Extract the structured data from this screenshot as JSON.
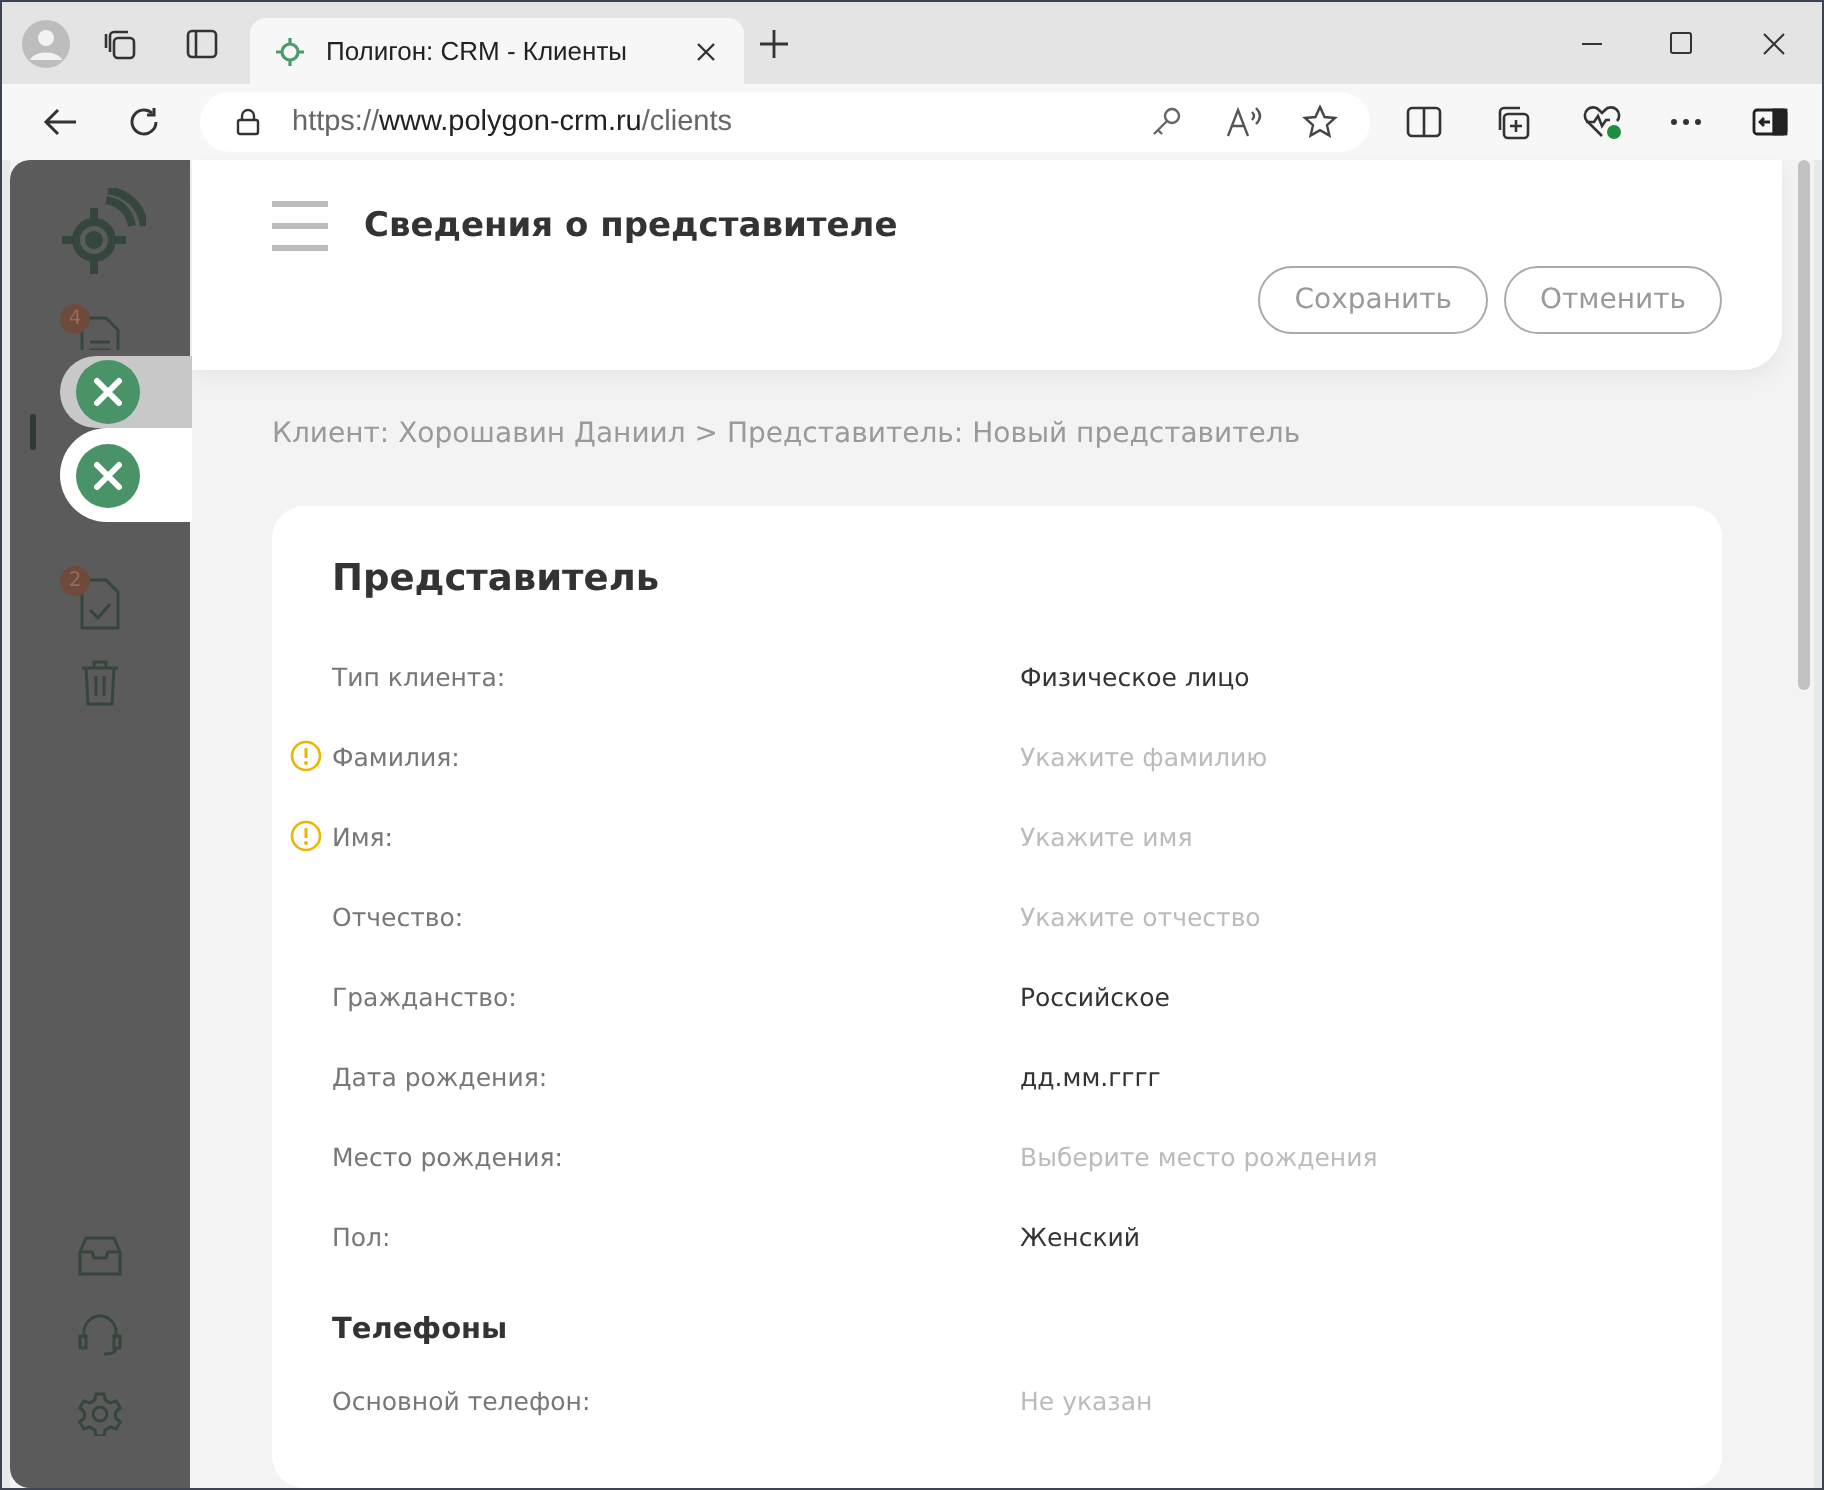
{
  "browser": {
    "tab_title": "Полигон: CRM - Клиенты",
    "url_scheme": "https://",
    "url_host": "www.polygon-crm.ru",
    "url_path": "/clients"
  },
  "sidebar": {
    "badges": [
      {
        "count": "4"
      },
      {
        "count": "2"
      }
    ]
  },
  "drawer_tabs": [
    {
      "selected": false
    },
    {
      "selected": true
    }
  ],
  "header": {
    "title": "Сведения о представителе",
    "buttons": [
      "Сохранить",
      "Отменить"
    ]
  },
  "breadcrumb": "Клиент: Хорошавин Даниил > Представитель: Новый представитель",
  "card": {
    "title": "Представитель",
    "fields": [
      {
        "label": "Тип клиента:",
        "value": "Физическое лицо",
        "warning": false
      },
      {
        "label": "Фамилия:",
        "placeholder": "Укажите фамилию",
        "warning": true
      },
      {
        "label": "Имя:",
        "placeholder": "Укажите имя",
        "warning": true
      },
      {
        "label": "Отчество:",
        "placeholder": "Укажите отчество",
        "warning": false
      },
      {
        "label": "Гражданство:",
        "value": "Российское",
        "warning": false
      },
      {
        "label": "Дата рождения:",
        "value": "дд.мм.гггг",
        "warning": false
      },
      {
        "label": "Место рождения:",
        "placeholder": "Выберите место рождения",
        "warning": false
      },
      {
        "label": "Пол:",
        "value": "Женский",
        "warning": false
      }
    ],
    "phones_title": "Телефоны",
    "phones": [
      {
        "label": "Основной телефон:",
        "placeholder": "Не указан",
        "warning": false
      }
    ]
  }
}
